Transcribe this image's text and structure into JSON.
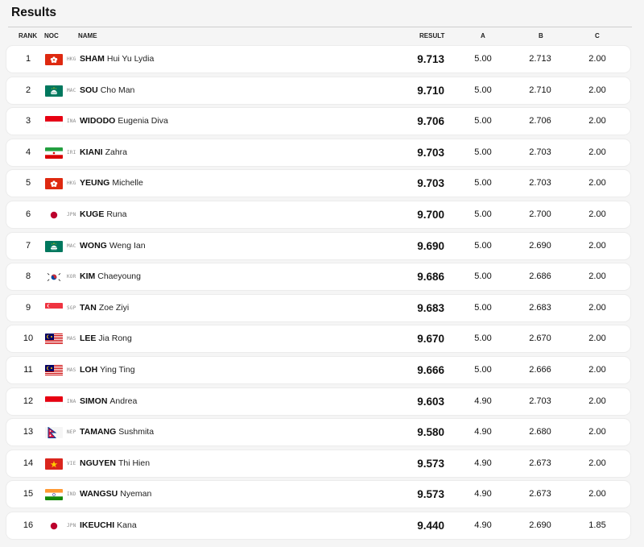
{
  "title": "Results",
  "headers": {
    "rank": "RANK",
    "noc": "NOC",
    "name": "NAME",
    "result": "RESULT",
    "a": "A",
    "b": "B",
    "c": "C"
  },
  "rows": [
    {
      "rank": "1",
      "flag": "flag-hkg-icon",
      "noc": "HKG",
      "surname": "SHAM",
      "given": "Hui Yu Lydia",
      "result": "9.713",
      "a": "5.00",
      "b": "2.713",
      "c": "2.00"
    },
    {
      "rank": "2",
      "flag": "flag-mac-icon",
      "noc": "MAC",
      "surname": "SOU",
      "given": "Cho Man",
      "result": "9.710",
      "a": "5.00",
      "b": "2.710",
      "c": "2.00"
    },
    {
      "rank": "3",
      "flag": "flag-ina-icon",
      "noc": "INA",
      "surname": "WIDODO",
      "given": "Eugenia Diva",
      "result": "9.706",
      "a": "5.00",
      "b": "2.706",
      "c": "2.00"
    },
    {
      "rank": "4",
      "flag": "flag-iri-icon",
      "noc": "IRI",
      "surname": "KIANI",
      "given": "Zahra",
      "result": "9.703",
      "a": "5.00",
      "b": "2.703",
      "c": "2.00"
    },
    {
      "rank": "5",
      "flag": "flag-hkg-icon",
      "noc": "HKG",
      "surname": "YEUNG",
      "given": "Michelle",
      "result": "9.703",
      "a": "5.00",
      "b": "2.703",
      "c": "2.00"
    },
    {
      "rank": "6",
      "flag": "flag-jpn-icon",
      "noc": "JPN",
      "surname": "KUGE",
      "given": "Runa",
      "result": "9.700",
      "a": "5.00",
      "b": "2.700",
      "c": "2.00"
    },
    {
      "rank": "7",
      "flag": "flag-mac-icon",
      "noc": "MAC",
      "surname": "WONG",
      "given": "Weng Ian",
      "result": "9.690",
      "a": "5.00",
      "b": "2.690",
      "c": "2.00"
    },
    {
      "rank": "8",
      "flag": "flag-kor-icon",
      "noc": "KOR",
      "surname": "KIM",
      "given": "Chaeyoung",
      "result": "9.686",
      "a": "5.00",
      "b": "2.686",
      "c": "2.00"
    },
    {
      "rank": "9",
      "flag": "flag-sgp-icon",
      "noc": "SGP",
      "surname": "TAN",
      "given": "Zoe Ziyi",
      "result": "9.683",
      "a": "5.00",
      "b": "2.683",
      "c": "2.00"
    },
    {
      "rank": "10",
      "flag": "flag-mas-icon",
      "noc": "MAS",
      "surname": "LEE",
      "given": "Jia Rong",
      "result": "9.670",
      "a": "5.00",
      "b": "2.670",
      "c": "2.00"
    },
    {
      "rank": "11",
      "flag": "flag-mas-icon",
      "noc": "MAS",
      "surname": "LOH",
      "given": "Ying Ting",
      "result": "9.666",
      "a": "5.00",
      "b": "2.666",
      "c": "2.00"
    },
    {
      "rank": "12",
      "flag": "flag-ina-icon",
      "noc": "INA",
      "surname": "SIMON",
      "given": "Andrea",
      "result": "9.603",
      "a": "4.90",
      "b": "2.703",
      "c": "2.00"
    },
    {
      "rank": "13",
      "flag": "flag-nep-icon",
      "noc": "NEP",
      "surname": "TAMANG",
      "given": "Sushmita",
      "result": "9.580",
      "a": "4.90",
      "b": "2.680",
      "c": "2.00"
    },
    {
      "rank": "14",
      "flag": "flag-vie-icon",
      "noc": "VIE",
      "surname": "NGUYEN",
      "given": "Thi Hien",
      "result": "9.573",
      "a": "4.90",
      "b": "2.673",
      "c": "2.00"
    },
    {
      "rank": "15",
      "flag": "flag-ind-icon",
      "noc": "IND",
      "surname": "WANGSU",
      "given": "Nyeman",
      "result": "9.573",
      "a": "4.90",
      "b": "2.673",
      "c": "2.00"
    },
    {
      "rank": "16",
      "flag": "flag-jpn-icon",
      "noc": "JPN",
      "surname": "IKEUCHI",
      "given": "Kana",
      "result": "9.440",
      "a": "4.90",
      "b": "2.690",
      "c": "1.85"
    }
  ]
}
